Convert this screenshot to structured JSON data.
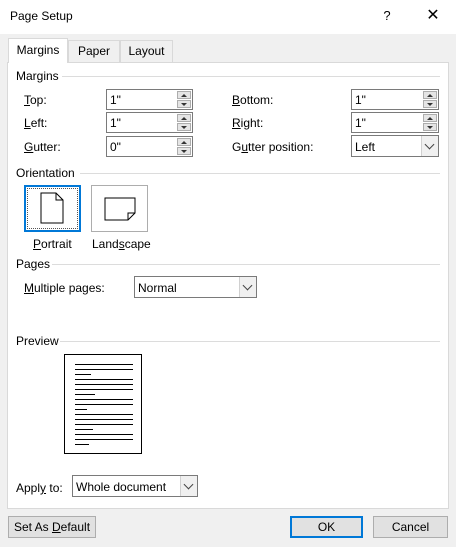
{
  "window": {
    "title": "Page Setup",
    "help": "?",
    "close": "✕"
  },
  "tabs": [
    {
      "label": "Margins",
      "active": true
    },
    {
      "label": "Paper",
      "active": false
    },
    {
      "label": "Layout",
      "active": false
    }
  ],
  "margins": {
    "group_label": "Margins",
    "top": {
      "label_accel": "T",
      "label_rest": "op:",
      "value": "1\""
    },
    "left": {
      "label_accel": "L",
      "label_rest": "eft:",
      "value": "1\""
    },
    "gutter": {
      "label_pre": "",
      "label_accel": "G",
      "label_rest": "utter:",
      "value": "0\""
    },
    "bottom": {
      "label_accel": "B",
      "label_rest": "ottom:",
      "value": "1\""
    },
    "right": {
      "label_accel": "R",
      "label_rest": "ight:",
      "value": "1\""
    },
    "gutter_position": {
      "label_pre": "G",
      "label_accel": "u",
      "label_rest": "tter position:",
      "value": "Left"
    }
  },
  "orientation": {
    "group_label": "Orientation",
    "portrait": {
      "label_accel": "P",
      "label_rest": "ortrait",
      "selected": true
    },
    "landscape": {
      "label_pre": "Land",
      "label_accel": "s",
      "label_rest": "cape",
      "selected": false
    }
  },
  "pages": {
    "group_label": "Pages",
    "multiple_pages": {
      "label_accel": "M",
      "label_rest": "ultiple pages:",
      "value": "Normal"
    }
  },
  "preview": {
    "group_label": "Preview"
  },
  "apply_to": {
    "label_pre": "Appl",
    "label_accel": "y",
    "label_rest": " to:",
    "value": "Whole document"
  },
  "buttons": {
    "set_default": {
      "label_pre": "Set As ",
      "label_accel": "D",
      "label_rest": "efault"
    },
    "ok": "OK",
    "cancel": "Cancel"
  },
  "colors": {
    "accent": "#0078d7",
    "panel_bg": "#ffffff",
    "dialog_bg": "#f0f0f0"
  }
}
